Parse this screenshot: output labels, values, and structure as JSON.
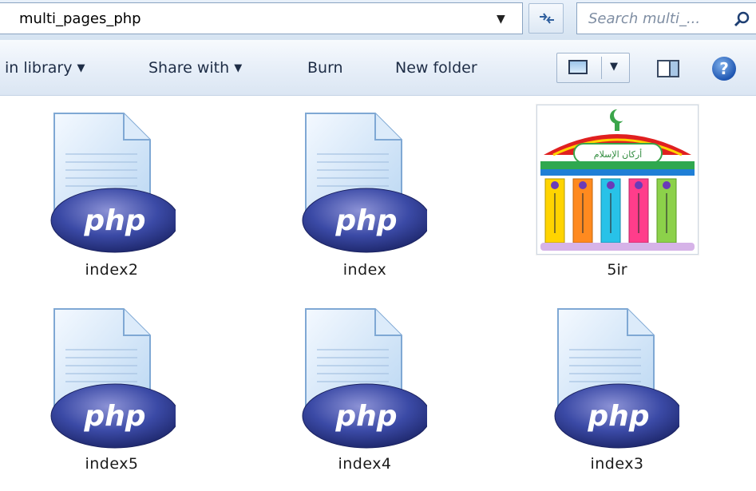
{
  "address_bar": {
    "path": "multi_pages_php",
    "search_placeholder": "Search multi_..."
  },
  "toolbar": {
    "include_library": "in library",
    "share_with": "Share with",
    "burn": "Burn",
    "new_folder": "New folder"
  },
  "files": [
    {
      "name": "index2",
      "type": "php-file"
    },
    {
      "name": "index",
      "type": "php-file"
    },
    {
      "name": "5ir",
      "type": "image"
    },
    {
      "name": "index5",
      "type": "php-file"
    },
    {
      "name": "index4",
      "type": "php-file"
    },
    {
      "name": "index3",
      "type": "php-file"
    }
  ],
  "icons": {
    "php_badge_text": "php",
    "help": "?"
  },
  "image_caption": "أركان الإسلام",
  "colors": {
    "php_oval": "#2e3a8c",
    "toolbar_bg": "#e6eef8",
    "accent_blue": "#1f57b3"
  }
}
